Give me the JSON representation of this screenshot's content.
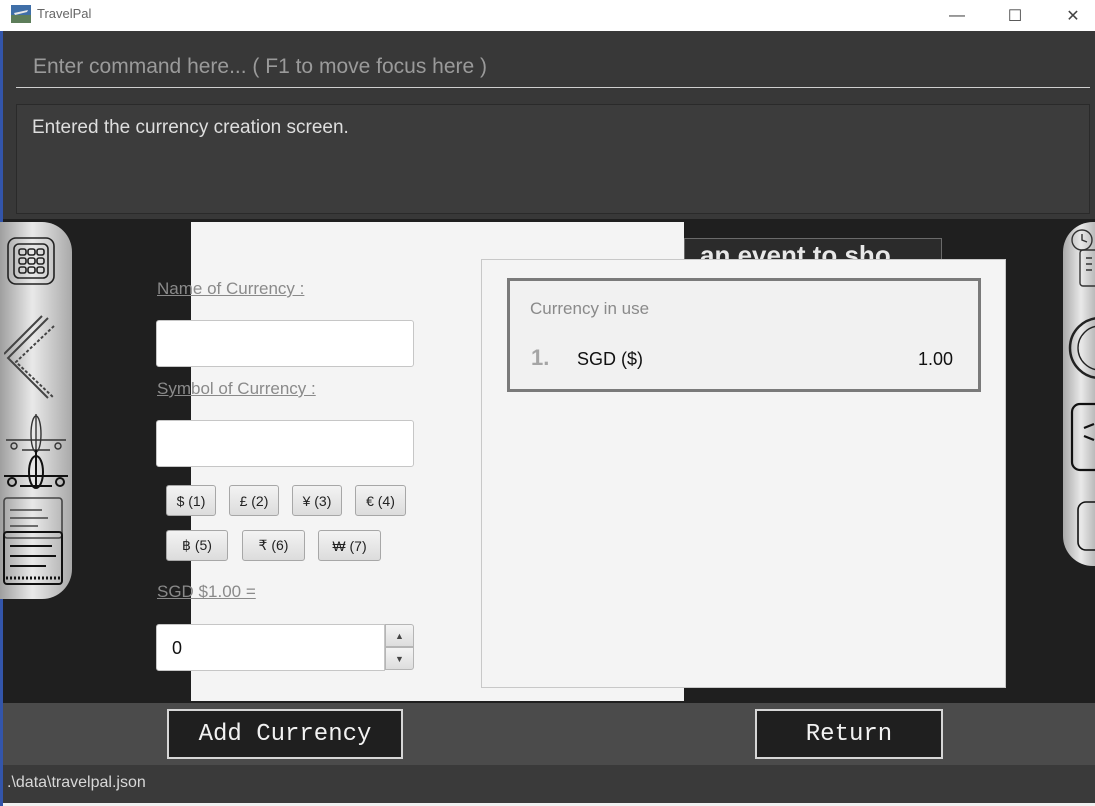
{
  "window": {
    "title": "TravelPal",
    "minimize_glyph": "—",
    "maximize_glyph": "☐",
    "close_glyph": "✕"
  },
  "command": {
    "placeholder": "Enter command here... ( F1 to move focus here )"
  },
  "result": {
    "message": "Entered the currency creation screen."
  },
  "background_panel": {
    "partial_text": "an event to sho"
  },
  "form": {
    "name_label": "Name of Currency :",
    "symbol_label": "Symbol of Currency :",
    "symbol_buttons": [
      "$ (1)",
      "£ (2)",
      "¥ (3)",
      "€ (4)",
      "฿ (5)",
      "₹ (6)",
      "₩ (7)"
    ],
    "rate_label": "SGD $1.00 =",
    "rate_value": "0",
    "spin_up": "▲",
    "spin_down": "▼"
  },
  "currency_list": {
    "title": "Currency in use",
    "items": [
      {
        "index": "1.",
        "name": "SGD ($)",
        "value": "1.00"
      }
    ]
  },
  "buttons": {
    "add": "Add Currency",
    "return": "Return"
  },
  "status": {
    "file_path": ".\\data\\travelpal.json"
  },
  "icons": {
    "left_nav": [
      "calendar-grid-icon",
      "chevron-left-icon",
      "airplane-icon",
      "list-icon"
    ],
    "right_nav": [
      "clock-icon",
      "gauge-icon",
      "wallet-icon"
    ]
  },
  "colors": {
    "dark_bg": "#1f1f1f",
    "command_bg": "#383838",
    "panel_bg": "#f4f4f4",
    "bottom_bar": "#4b4b4b"
  }
}
